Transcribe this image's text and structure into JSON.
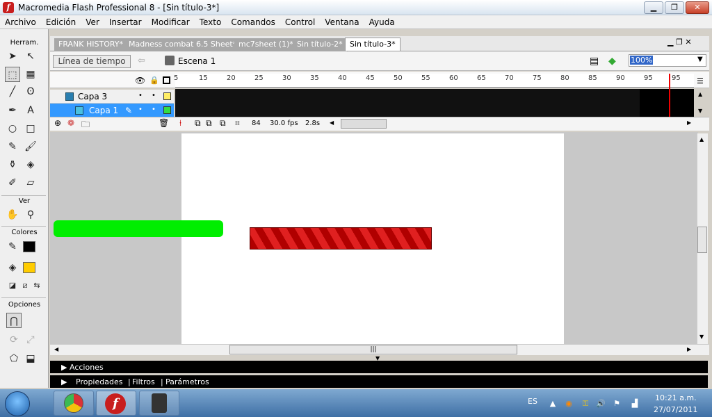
{
  "window": {
    "title": "Macromedia Flash Professional 8 - [Sin título-3*]",
    "icon_glyph": "f"
  },
  "menu": [
    "Archivo",
    "Edición",
    "Ver",
    "Insertar",
    "Modificar",
    "Texto",
    "Comandos",
    "Control",
    "Ventana",
    "Ayuda"
  ],
  "tools": {
    "title": "Herram.",
    "ver_label": "Ver",
    "colores_label": "Colores",
    "opciones_label": "Opciones",
    "stroke_color": "#000000",
    "fill_color": "#ffcc00"
  },
  "tabs": [
    "FRANK HISTORY*",
    "Madness combat 6.5 Sheet*",
    "mc7sheet (1)*",
    "Sin título-2*",
    "Sin título-3*"
  ],
  "nav": {
    "timeline_button": "Línea de tiempo",
    "scene": "Escena 1",
    "zoom": "100%"
  },
  "timeline": {
    "ruler": [
      "5",
      "10",
      "15",
      "20",
      "25",
      "30",
      "35",
      "40",
      "45",
      "50",
      "55",
      "60",
      "65",
      "70",
      "75",
      "80",
      "85",
      "90",
      "95"
    ],
    "layers": [
      {
        "name": "Capa 3"
      },
      {
        "name": "Capa 1"
      }
    ],
    "current_frame": "84",
    "frame_rate": "30.0 fps",
    "elapsed": "2.8s"
  },
  "panels": {
    "acciones": "Acciones",
    "propiedades": "Propiedades",
    "filtros": "Filtros",
    "parametros": "Parámetros"
  },
  "stage": {
    "green_bar_color": "#00ee00",
    "red_bar_color": "#c00000"
  },
  "taskbar": {
    "language": "ES",
    "time": "10:21 a.m.",
    "date": "27/07/2011"
  }
}
